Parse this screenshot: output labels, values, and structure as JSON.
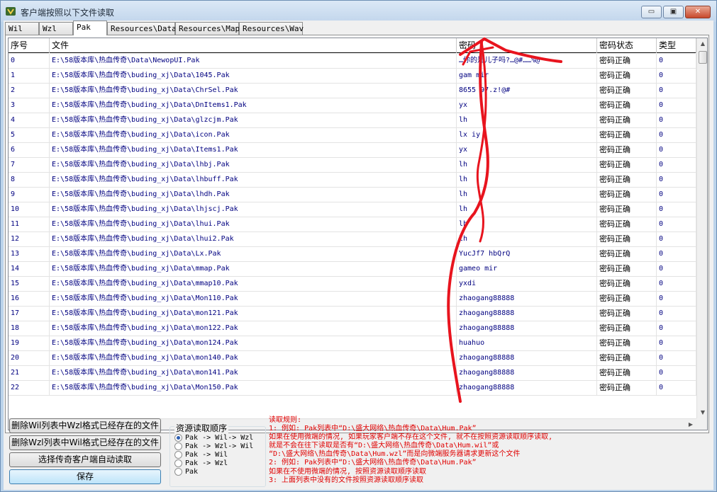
{
  "window": {
    "title": "客户端按照以下文件读取",
    "controls": {
      "minimize": "▭",
      "maximize": "▣",
      "close": "✕"
    }
  },
  "tabs": [
    {
      "label": "Wil",
      "active": false
    },
    {
      "label": "Wzl",
      "active": false
    },
    {
      "label": "Pak",
      "active": true
    },
    {
      "label": "Resources\\Data",
      "active": false
    },
    {
      "label": "Resources\\Map",
      "active": false
    },
    {
      "label": "Resources\\Wav",
      "active": false
    }
  ],
  "grid": {
    "columns": [
      "序号",
      "文件",
      "密码",
      "密码状态",
      "类型"
    ],
    "rows": [
      {
        "index": "0",
        "file": "E:\\58版本库\\热血传奇\\Data\\NewopUI.Pak",
        "password": "…你的是儿子吗?…@#……%@",
        "status": "密码正确",
        "type": "0"
      },
      {
        "index": "1",
        "file": "E:\\58版本库\\热血传奇\\buding_xj\\Data\\1045.Pak",
        "password": "gam    mir",
        "status": "密码正确",
        "type": "0"
      },
      {
        "index": "2",
        "file": "E:\\58版本库\\热血传奇\\buding_xj\\Data\\ChrSel.Pak",
        "password": "8655  97.z!@#",
        "status": "密码正确",
        "type": "0"
      },
      {
        "index": "3",
        "file": "E:\\58版本库\\热血传奇\\buding_xj\\Data\\DnItems1.Pak",
        "password": "yx",
        "status": "密码正确",
        "type": "0"
      },
      {
        "index": "4",
        "file": "E:\\58版本库\\热血传奇\\buding_xj\\Data\\glzcjm.Pak",
        "password": "lh",
        "status": "密码正确",
        "type": "0"
      },
      {
        "index": "5",
        "file": "E:\\58版本库\\热血传奇\\buding_xj\\Data\\icon.Pak",
        "password": "lx  iy",
        "status": "密码正确",
        "type": "0"
      },
      {
        "index": "6",
        "file": "E:\\58版本库\\热血传奇\\buding_xj\\Data\\Items1.Pak",
        "password": "yx",
        "status": "密码正确",
        "type": "0"
      },
      {
        "index": "7",
        "file": "E:\\58版本库\\热血传奇\\buding_xj\\Data\\lhbj.Pak",
        "password": "lh",
        "status": "密码正确",
        "type": "0"
      },
      {
        "index": "8",
        "file": "E:\\58版本库\\热血传奇\\buding_xj\\Data\\lhbuff.Pak",
        "password": "lh",
        "status": "密码正确",
        "type": "0"
      },
      {
        "index": "9",
        "file": "E:\\58版本库\\热血传奇\\buding_xj\\Data\\lhdh.Pak",
        "password": "lh",
        "status": "密码正确",
        "type": "0"
      },
      {
        "index": "10",
        "file": "E:\\58版本库\\热血传奇\\buding_xj\\Data\\lhjscj.Pak",
        "password": "lh",
        "status": "密码正确",
        "type": "0"
      },
      {
        "index": "11",
        "file": "E:\\58版本库\\热血传奇\\buding_xj\\Data\\lhui.Pak",
        "password": "lh",
        "status": "密码正确",
        "type": "0"
      },
      {
        "index": "12",
        "file": "E:\\58版本库\\热血传奇\\buding_xj\\Data\\lhui2.Pak",
        "password": "lh",
        "status": "密码正确",
        "type": "0"
      },
      {
        "index": "13",
        "file": "E:\\58版本库\\热血传奇\\buding_xj\\Data\\Lx.Pak",
        "password": "YucJf7  hbQrQ",
        "status": "密码正确",
        "type": "0"
      },
      {
        "index": "14",
        "file": "E:\\58版本库\\热血传奇\\buding_xj\\Data\\mmap.Pak",
        "password": "gameo  mir",
        "status": "密码正确",
        "type": "0"
      },
      {
        "index": "15",
        "file": "E:\\58版本库\\热血传奇\\buding_xj\\Data\\mmap10.Pak",
        "password": "yxdi",
        "status": "密码正确",
        "type": "0"
      },
      {
        "index": "16",
        "file": "E:\\58版本库\\热血传奇\\buding_xj\\Data\\Mon110.Pak",
        "password": "zhaogang88888",
        "status": "密码正确",
        "type": "0"
      },
      {
        "index": "17",
        "file": "E:\\58版本库\\热血传奇\\buding_xj\\Data\\mon121.Pak",
        "password": "zhaogang88888",
        "status": "密码正确",
        "type": "0"
      },
      {
        "index": "18",
        "file": "E:\\58版本库\\热血传奇\\buding_xj\\Data\\mon122.Pak",
        "password": "zhaogang88888",
        "status": "密码正确",
        "type": "0"
      },
      {
        "index": "19",
        "file": "E:\\58版本库\\热血传奇\\buding_xj\\Data\\mon124.Pak",
        "password": "huahuo",
        "status": "密码正确",
        "type": "0"
      },
      {
        "index": "20",
        "file": "E:\\58版本库\\热血传奇\\buding_xj\\Data\\mon140.Pak",
        "password": "zhaogang88888",
        "status": "密码正确",
        "type": "0"
      },
      {
        "index": "21",
        "file": "E:\\58版本库\\热血传奇\\buding_xj\\Data\\mon141.Pak",
        "password": "zhaogang88888",
        "status": "密码正确",
        "type": "0"
      },
      {
        "index": "22",
        "file": "E:\\58版本库\\热血传奇\\buding_xj\\Data\\Mon150.Pak",
        "password": "zhaogang88888",
        "status": "密码正确",
        "type": "0"
      }
    ]
  },
  "buttons": {
    "delete_wzl": "删除Wil列表中Wzl格式已经存在的文件",
    "delete_wil": "删除Wzl列表中Wil格式已经存在的文件",
    "select_client": "选择传奇客户端自动读取",
    "save": "保存"
  },
  "order_group": {
    "title": "资源读取顺序",
    "options": [
      {
        "label": "Pak -> Wil-> Wzl",
        "selected": true
      },
      {
        "label": "Pak -> Wzl-> Wil",
        "selected": false
      },
      {
        "label": "Pak -> Wil",
        "selected": false
      },
      {
        "label": "Pak -> Wzl",
        "selected": false
      },
      {
        "label": "Pak",
        "selected": false
      }
    ]
  },
  "rules": [
    "读取规则:",
    "1: 例如: Pak列表中“D:\\盛大网络\\热血传奇\\Data\\Hum.Pak”",
    "   如果在使用微端的情况, 如果玩家客户端不存在这个文件, 就不在按照资源读取顺序读取,",
    "   就是不会在往下读取是否有“D:\\盛大网络\\热血传奇\\Data\\Hum.wil”或",
    "   “D:\\盛大网络\\热血传奇\\Data\\Hum.wzl”而是向微端服务器请求更新这个文件",
    "2: 例如: Pak列表中“D:\\盛大网络\\热血传奇\\Data\\Hum.Pak”",
    "   如果在不使用微端的情况, 按照资源读取顺序读取",
    "3: 上面列表中没有的文件按照资源读取顺序读取"
  ],
  "colors": {
    "annotation": "#e8141e",
    "rules_text": "#e00000",
    "cell_text": "#000080"
  },
  "icons": {
    "app": "app-logo-icon",
    "radio": "radio-dot-icon",
    "scroll_up": "▲",
    "scroll_down": "▼",
    "scroll_left": "◀",
    "scroll_right": "▶"
  }
}
